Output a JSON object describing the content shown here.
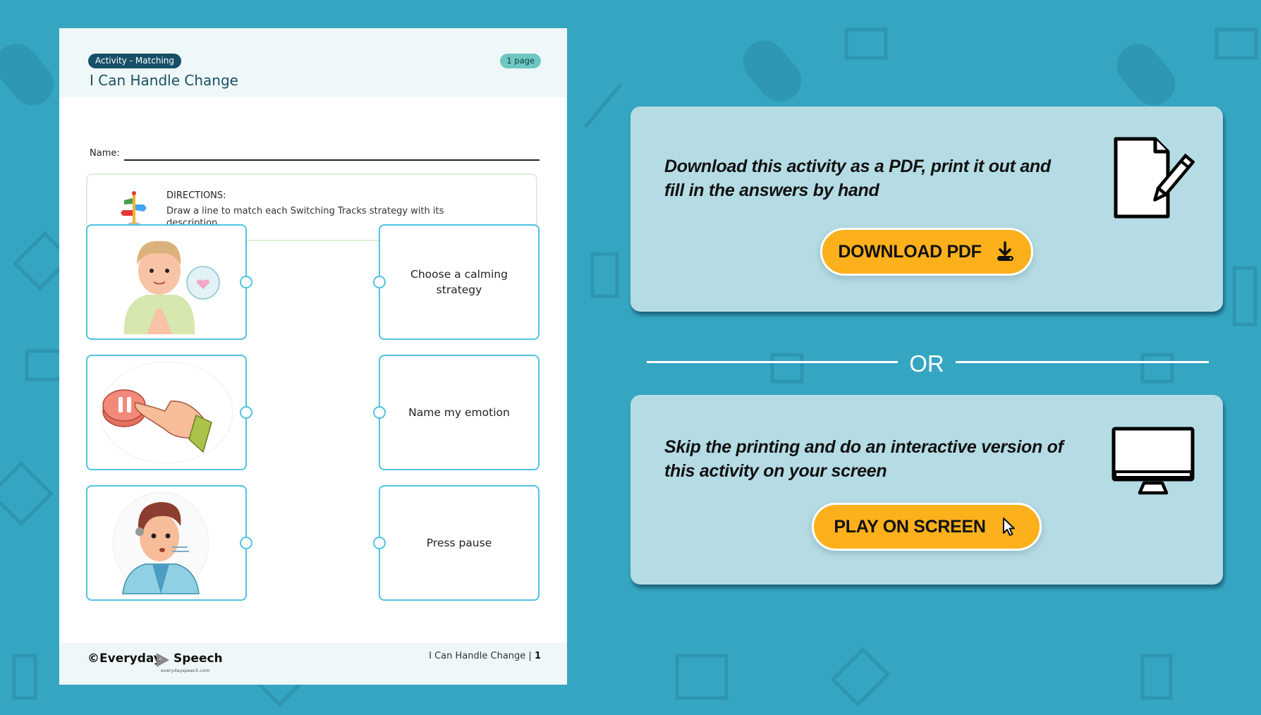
{
  "worksheet": {
    "activity_badge": "Activity - Matching",
    "pages_badge": "1 page",
    "title": "I Can Handle Change",
    "name_label": "Name:",
    "directions": {
      "icon": "signpost-icon",
      "title": "DIRECTIONS:",
      "text": "Draw a line to match each Switching Tracks strategy with its description."
    },
    "left_items": [
      {
        "icon": "child-hands-on-heart-illustration"
      },
      {
        "icon": "finger-pressing-pause-button-illustration"
      },
      {
        "icon": "boy-breathing-out-illustration"
      }
    ],
    "right_items": [
      {
        "label": "Choose a calming strategy"
      },
      {
        "label": "Name my emotion"
      },
      {
        "label": "Press pause"
      }
    ],
    "footer": {
      "copyright": "©Everyday",
      "brand_second": "Speech",
      "url": "everydayspeech.com",
      "doc_title": "I Can Handle Change",
      "separator": "|",
      "page_number": "1"
    }
  },
  "options": {
    "print": {
      "text": "Download this activity as a PDF, print it out and fill in the answers by hand",
      "button_label": "DOWNLOAD PDF",
      "button_icon": "download-icon",
      "illustration": "document-pencil-icon"
    },
    "divider_label": "OR",
    "screen": {
      "text": "Skip the printing and do an interactive version of this activity on your screen",
      "button_label": "PLAY ON SCREEN",
      "button_icon": "pointer-cursor-icon",
      "illustration": "monitor-icon"
    }
  },
  "colors": {
    "background": "#35a6c2",
    "card": "#b5dce4",
    "button": "#fbb01c",
    "badge_dark": "#164f66",
    "badge_light": "#6ec7c1",
    "match_border": "#4fc4e2"
  }
}
